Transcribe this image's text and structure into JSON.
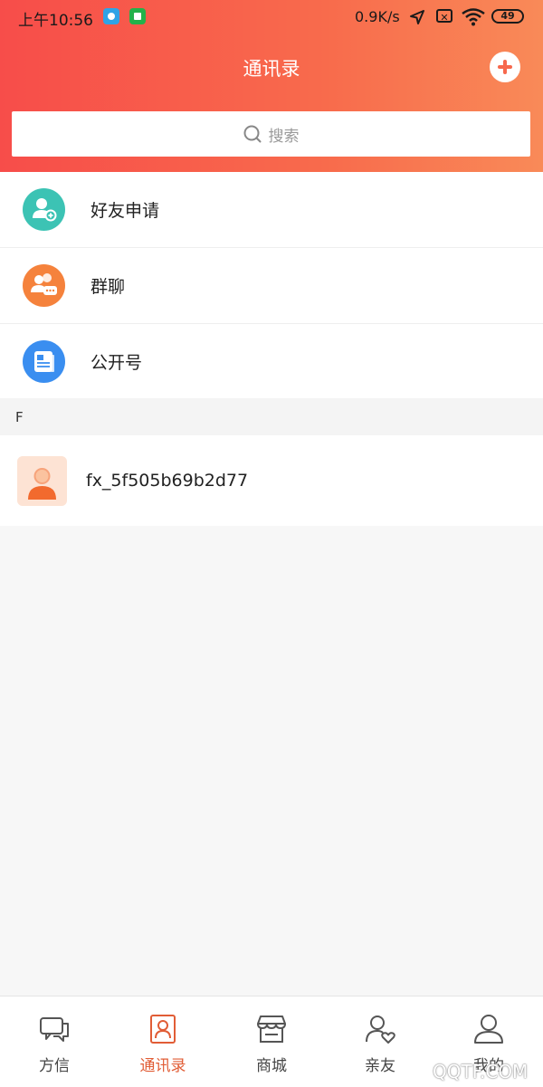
{
  "status_bar": {
    "time": "上午10:56",
    "speed": "0.9K/s",
    "battery": "49"
  },
  "header": {
    "title": "通讯录"
  },
  "search": {
    "placeholder": "搜索"
  },
  "quick_items": [
    {
      "label": "好友申请",
      "icon": "add-friend-icon",
      "color": "#3cc3b4"
    },
    {
      "label": "群聊",
      "icon": "group-chat-icon",
      "color": "#f5823c"
    },
    {
      "label": "公开号",
      "icon": "public-account-icon",
      "color": "#3a8ef0"
    }
  ],
  "section": {
    "letter": "F"
  },
  "contacts": [
    {
      "name": "fx_5f505b69b2d77"
    }
  ],
  "tabs": [
    {
      "label": "方信",
      "icon": "chat-icon"
    },
    {
      "label": "通讯录",
      "icon": "contacts-icon",
      "active": true
    },
    {
      "label": "商城",
      "icon": "store-icon"
    },
    {
      "label": "亲友",
      "icon": "relatives-icon"
    },
    {
      "label": "我的",
      "icon": "profile-icon"
    }
  ],
  "colors": {
    "accent": "#e15d36",
    "header_start": "#f74d4a",
    "header_end": "#f98a58"
  },
  "watermark": "QQTF.COM"
}
